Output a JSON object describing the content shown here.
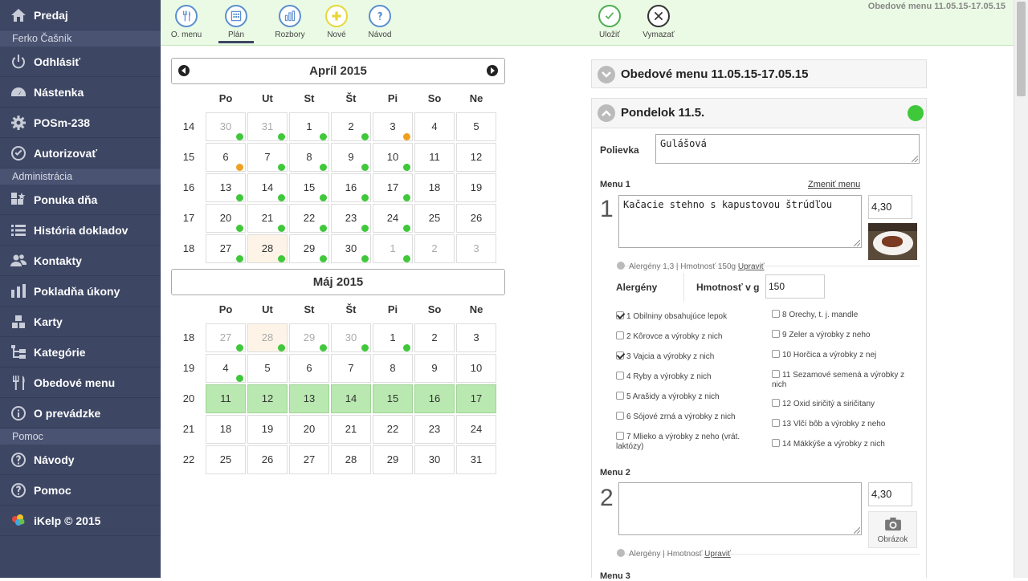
{
  "sidebar": {
    "items": [
      {
        "label": "Predaj",
        "icon": "home-icon"
      },
      {
        "section": "Ferko Čašník"
      },
      {
        "label": "Odhlásiť",
        "icon": "power-icon"
      },
      {
        "label": "Nástenka",
        "icon": "dashboard-icon"
      },
      {
        "label": "POSm-238",
        "icon": "gear-icon"
      },
      {
        "label": "Autorizovať",
        "icon": "check-circle-icon"
      },
      {
        "section": "Administrácia"
      },
      {
        "label": "Ponuka dňa",
        "icon": "star-grid-icon"
      },
      {
        "label": "História dokladov",
        "icon": "list-icon"
      },
      {
        "label": "Kontakty",
        "icon": "users-icon"
      },
      {
        "label": "Pokladňa úkony",
        "icon": "bar-chart-icon"
      },
      {
        "label": "Karty",
        "icon": "cards-icon"
      },
      {
        "label": "Kategórie",
        "icon": "tree-icon"
      },
      {
        "label": "Obedové menu",
        "icon": "fork-knife-icon"
      },
      {
        "label": "O prevádzke",
        "icon": "info-icon"
      },
      {
        "section": "Pomoc"
      },
      {
        "label": "Návody",
        "icon": "question-icon"
      },
      {
        "label": "Pomoc",
        "icon": "question-icon"
      },
      {
        "label": "iKelp © 2015",
        "icon": "ikelp-logo-icon"
      }
    ]
  },
  "toolbar": {
    "title": "Obedové menu 11.05.15-17.05.15",
    "buttons": [
      {
        "label": "O. menu",
        "icon": "fork-knife-icon",
        "color": "#5b8fd0"
      },
      {
        "label": "Plán",
        "icon": "calendar-grid-icon",
        "color": "#5b8fd0",
        "active": true
      },
      {
        "label": "Rozbory",
        "icon": "bar-chart-icon",
        "color": "#5b8fd0"
      },
      {
        "label": "Nové",
        "icon": "plus-icon",
        "color": "#e8d63a"
      },
      {
        "label": "Návod",
        "icon": "question-icon",
        "color": "#5b8fd0"
      },
      {
        "label": "Uložiť",
        "icon": "check-icon",
        "color": "#4caf50"
      },
      {
        "label": "Vymazať",
        "icon": "close-icon",
        "color": "#333333"
      }
    ]
  },
  "calendar": {
    "dow": [
      "Po",
      "Ut",
      "St",
      "Št",
      "Pi",
      "So",
      "Ne"
    ],
    "months": [
      {
        "title": "Apríl 2015",
        "weeks": [
          {
            "wk": "14",
            "days": [
              [
                "30",
                "other",
                "green"
              ],
              [
                "31",
                "other",
                "green"
              ],
              [
                "1",
                "",
                "green"
              ],
              [
                "2",
                "",
                "green"
              ],
              [
                "3",
                "",
                "orange"
              ],
              [
                "4",
                "",
                ""
              ],
              [
                "5",
                "",
                ""
              ]
            ]
          },
          {
            "wk": "15",
            "days": [
              [
                "6",
                "",
                "orange"
              ],
              [
                "7",
                "",
                "green"
              ],
              [
                "8",
                "",
                "green"
              ],
              [
                "9",
                "",
                "green"
              ],
              [
                "10",
                "",
                "green"
              ],
              [
                "11",
                "",
                ""
              ],
              [
                "12",
                "",
                ""
              ]
            ]
          },
          {
            "wk": "16",
            "days": [
              [
                "13",
                "",
                "green"
              ],
              [
                "14",
                "",
                "green"
              ],
              [
                "15",
                "",
                "green"
              ],
              [
                "16",
                "",
                "green"
              ],
              [
                "17",
                "",
                "green"
              ],
              [
                "18",
                "",
                ""
              ],
              [
                "19",
                "",
                ""
              ]
            ]
          },
          {
            "wk": "17",
            "days": [
              [
                "20",
                "",
                "green"
              ],
              [
                "21",
                "",
                "green"
              ],
              [
                "22",
                "",
                "green"
              ],
              [
                "23",
                "",
                "green"
              ],
              [
                "24",
                "",
                "green"
              ],
              [
                "25",
                "",
                ""
              ],
              [
                "26",
                "",
                ""
              ]
            ]
          },
          {
            "wk": "18",
            "days": [
              [
                "27",
                "",
                "green"
              ],
              [
                "28",
                "today",
                "green"
              ],
              [
                "29",
                "",
                "green"
              ],
              [
                "30",
                "",
                "green"
              ],
              [
                "1",
                "other",
                "green"
              ],
              [
                "2",
                "other",
                ""
              ],
              [
                "3",
                "other",
                ""
              ]
            ]
          }
        ]
      },
      {
        "title": "Máj 2015",
        "weeks": [
          {
            "wk": "18",
            "days": [
              [
                "27",
                "other",
                "green"
              ],
              [
                "28",
                "other today",
                "green"
              ],
              [
                "29",
                "other",
                "green"
              ],
              [
                "30",
                "other",
                "green"
              ],
              [
                "1",
                "",
                "green"
              ],
              [
                "2",
                "",
                ""
              ],
              [
                "3",
                "",
                ""
              ]
            ]
          },
          {
            "wk": "19",
            "days": [
              [
                "4",
                "",
                "green"
              ],
              [
                "5",
                "",
                ""
              ],
              [
                "6",
                "",
                ""
              ],
              [
                "7",
                "",
                ""
              ],
              [
                "8",
                "",
                ""
              ],
              [
                "9",
                "",
                ""
              ],
              [
                "10",
                "",
                ""
              ]
            ]
          },
          {
            "wk": "20",
            "days": [
              [
                "11",
                "sel",
                ""
              ],
              [
                "12",
                "sel",
                ""
              ],
              [
                "13",
                "sel",
                ""
              ],
              [
                "14",
                "sel",
                ""
              ],
              [
                "15",
                "sel",
                ""
              ],
              [
                "16",
                "sel",
                ""
              ],
              [
                "17",
                "sel",
                ""
              ]
            ]
          },
          {
            "wk": "21",
            "days": [
              [
                "18",
                "",
                ""
              ],
              [
                "19",
                "",
                ""
              ],
              [
                "20",
                "",
                ""
              ],
              [
                "21",
                "",
                ""
              ],
              [
                "22",
                "",
                ""
              ],
              [
                "23",
                "",
                ""
              ],
              [
                "24",
                "",
                ""
              ]
            ]
          },
          {
            "wk": "22",
            "days": [
              [
                "25",
                "",
                ""
              ],
              [
                "26",
                "",
                ""
              ],
              [
                "27",
                "",
                ""
              ],
              [
                "28",
                "",
                ""
              ],
              [
                "29",
                "",
                ""
              ],
              [
                "30",
                "",
                ""
              ],
              [
                "31",
                "",
                ""
              ]
            ]
          }
        ]
      }
    ],
    "dot_colors": {
      "green": "#3fc83a",
      "orange": "#f0a020"
    }
  },
  "panel": {
    "menu_title": "Obedové menu 11.05.15-17.05.15",
    "day_title": "Pondelok 11.5.",
    "status_color": "#3fc83a",
    "soup_label": "Polievka",
    "soup_value": "Gulášová",
    "menu1": {
      "label": "Menu 1",
      "change_link": "Zmeniť menu",
      "number": "1",
      "dish": "Kačacie stehno s kapustovou štrúdľou",
      "price": "4,30",
      "meta_text": "Alergény 1,3 | Hmotnosť 150g",
      "meta_link": "Upraviť",
      "allergen_label": "Alergény",
      "weight_label": "Hmotnosť v g",
      "weight_value": "150"
    },
    "allergens_left": [
      {
        "text": "1 Obilniny obsahujúce lepok",
        "checked": true
      },
      {
        "text": "2 Kôrovce a výrobky z nich",
        "checked": false
      },
      {
        "text": "3 Vajcia a výrobky z nich",
        "checked": true
      },
      {
        "text": "4 Ryby a výrobky z nich",
        "checked": false
      },
      {
        "text": "5 Arašidy a výrobky z nich",
        "checked": false
      },
      {
        "text": "6 Sójové zrná a výrobky z nich",
        "checked": false
      },
      {
        "text": "7 Mlieko a výrobky z neho (vrát. laktózy)",
        "checked": false
      }
    ],
    "allergens_right": [
      {
        "text": "8 Orechy, t. j. mandle",
        "checked": false
      },
      {
        "text": "9 Zeler a výrobky z neho",
        "checked": false
      },
      {
        "text": "10 Horčica a výrobky z nej",
        "checked": false
      },
      {
        "text": "11 Sezamové semená a výrobky z nich",
        "checked": false
      },
      {
        "text": "12 Oxid siričitý a siričitany",
        "checked": false
      },
      {
        "text": "13 Vlčí bôb a výrobky z neho",
        "checked": false
      },
      {
        "text": "14 Mäkkýše a výrobky z nich",
        "checked": false
      }
    ],
    "menu2": {
      "label": "Menu 2",
      "number": "2",
      "dish": "",
      "price": "4,30",
      "image_label": "Obrázok",
      "meta_text": "Alergény | Hmotnosť",
      "meta_link": "Upraviť"
    },
    "menu3": {
      "label": "Menu 3"
    }
  }
}
